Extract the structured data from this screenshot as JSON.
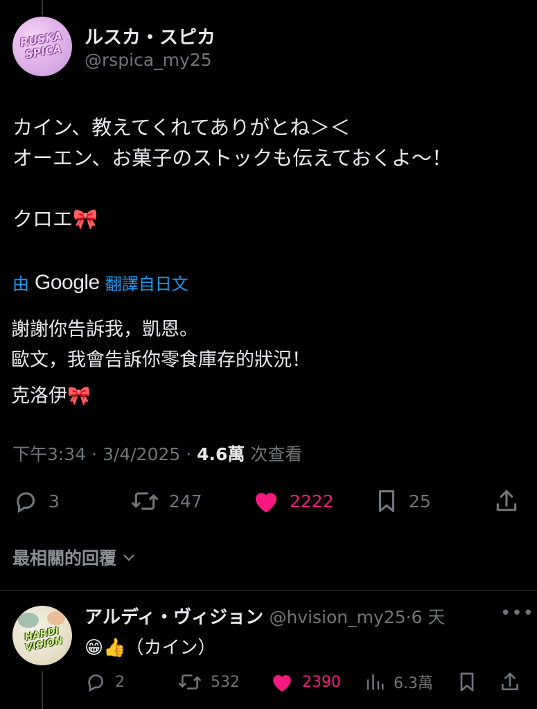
{
  "tweet": {
    "author": {
      "display_name": "ルスカ・スピカ",
      "handle": "@rspica_my25",
      "avatar_logo": "RUSKA SPICA"
    },
    "text_lines": [
      "カイン、教えてくれてありがとね＞＜",
      "オーエン、お菓子のストックも伝えておくよ～！"
    ],
    "signoff": "クロエ🎀",
    "translation": {
      "prefix": "由",
      "brand": "Google",
      "suffix": "翻譯自日文",
      "lines": [
        "謝謝你告訴我，凱恩。",
        "歐文，我會告訴你零食庫存的狀況！"
      ],
      "signoff": "克洛伊🎀"
    },
    "meta": {
      "time": "下午3:34",
      "date": "3/4/2025",
      "views": "4.6萬",
      "views_label": "次查看",
      "sep": "·"
    },
    "actions": {
      "replies": "3",
      "retweets": "247",
      "likes": "2222",
      "bookmarks": "25"
    },
    "colors": {
      "like": "#f91880",
      "link": "#1d9bf0",
      "muted": "#71767b"
    }
  },
  "sort": {
    "label": "最相關的回覆"
  },
  "reply": {
    "display_name": "アルディ・ヴィジョン",
    "handle": "@hvision_my25",
    "sep": "·",
    "time": "6 天",
    "avatar_logo": "HARDI VISION",
    "text": "😁👍（カイン）",
    "actions": {
      "replies": "2",
      "retweets": "532",
      "likes": "2390",
      "views": "6.3萬"
    }
  }
}
